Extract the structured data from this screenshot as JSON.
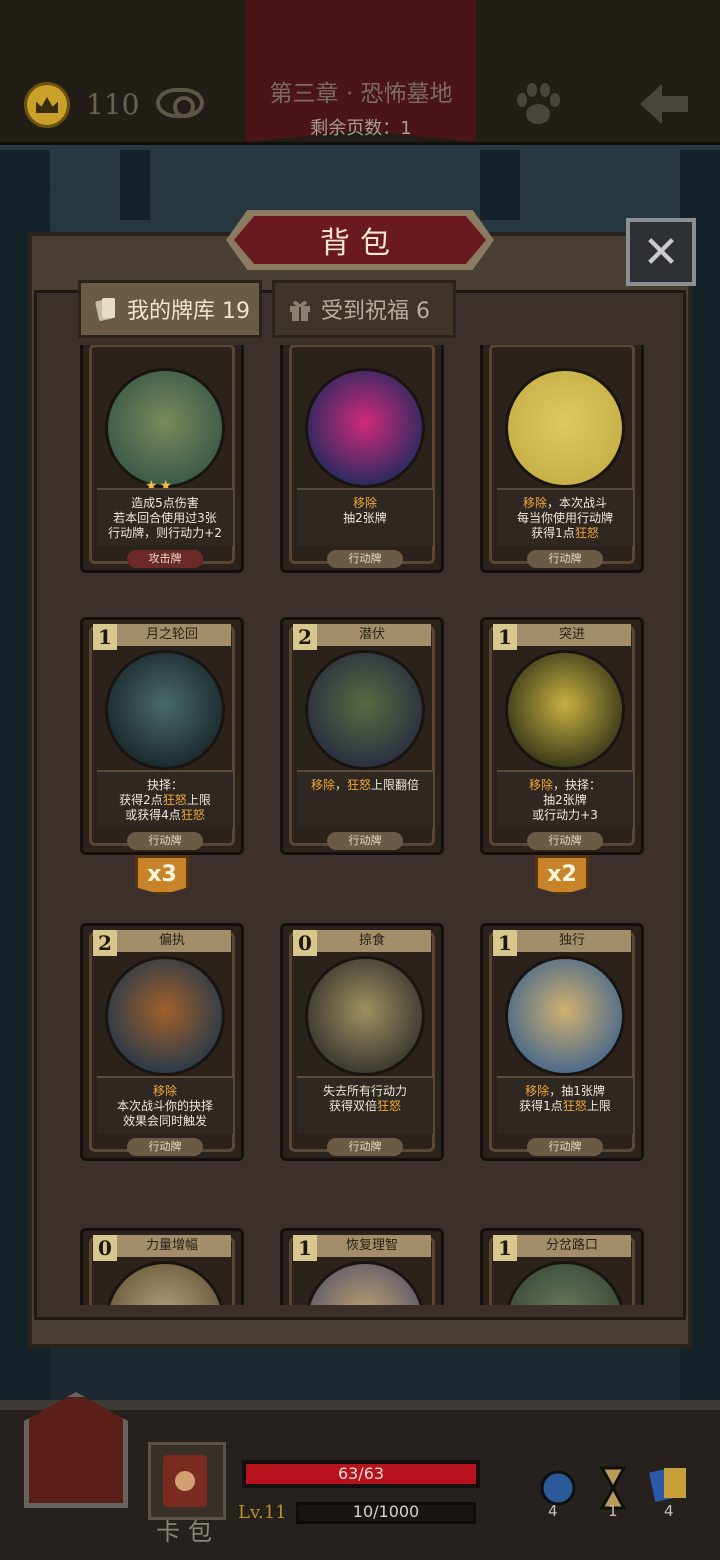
{
  "top": {
    "coins": "110",
    "chapter": "第三章 · 恐怖墓地",
    "pages_left": "剩余页数：1"
  },
  "bag": {
    "title": "背包",
    "close": "✕",
    "tabs": [
      {
        "label": "我的牌库 19"
      },
      {
        "label": "受到祝福 6"
      }
    ]
  },
  "cards": [
    {
      "name": "",
      "cost": "",
      "desc": [
        "造成5点伤害",
        "若本回合使用过3张",
        "行动牌，则行动力+2"
      ],
      "type": "攻击牌",
      "stars": "★★"
    },
    {
      "name": "",
      "cost": "",
      "desc_hl": "移除",
      "desc": [
        "抽2张牌"
      ],
      "type": "行动牌"
    },
    {
      "name": "",
      "cost": "",
      "desc": [
        "移除，本次战斗",
        "每当你使用行动牌",
        "获得1点狂怒"
      ],
      "type": "行动牌"
    },
    {
      "name": "月之轮回",
      "cost": "1",
      "desc": [
        "抉择：",
        "获得2点狂怒上限",
        "或获得4点狂怒"
      ],
      "type": "行动牌",
      "multi": "x3"
    },
    {
      "name": "潜伏",
      "cost": "2",
      "desc": [
        "移除，狂怒上限翻倍"
      ],
      "type": "行动牌"
    },
    {
      "name": "突进",
      "cost": "1",
      "desc": [
        "移除，抉择：",
        "抽2张牌",
        "或行动力+3"
      ],
      "type": "行动牌",
      "multi": "x2"
    },
    {
      "name": "偏执",
      "cost": "2",
      "desc": [
        "移除",
        "本次战斗你的抉择",
        "效果会同时触发"
      ],
      "type": "行动牌"
    },
    {
      "name": "掠食",
      "cost": "0",
      "desc": [
        "失去所有行动力",
        "获得双倍狂怒"
      ],
      "type": "行动牌"
    },
    {
      "name": "独行",
      "cost": "1",
      "desc": [
        "移除，抽1张牌",
        "获得1点狂怒上限"
      ],
      "type": "行动牌"
    },
    {
      "name": "力量增幅",
      "cost": "0",
      "desc": [],
      "type": ""
    },
    {
      "name": "恢复理智",
      "cost": "1",
      "desc": [],
      "type": ""
    },
    {
      "name": "分岔路口",
      "cost": "1",
      "desc": [],
      "type": ""
    }
  ],
  "hud": {
    "cardbag_label": "卡包",
    "hp": "63/63",
    "hp_fraction": 1.0,
    "level": "Lv.11",
    "xp": "10/1000",
    "resources": [
      "4",
      "1",
      "4"
    ]
  }
}
